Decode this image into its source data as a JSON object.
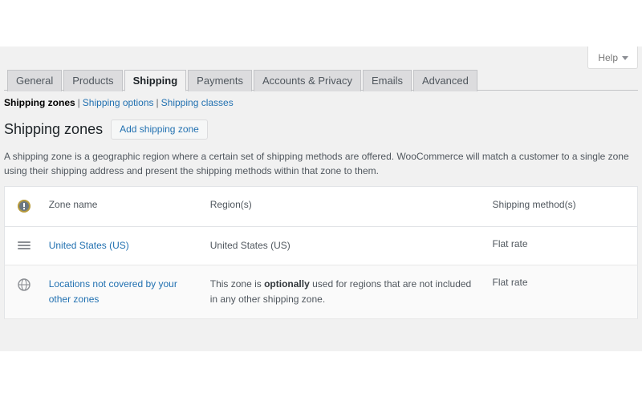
{
  "help": {
    "label": "Help",
    "caret_icon": "chevron-down-icon"
  },
  "tabs": [
    {
      "label": "General",
      "active": false
    },
    {
      "label": "Products",
      "active": false
    },
    {
      "label": "Shipping",
      "active": true
    },
    {
      "label": "Payments",
      "active": false
    },
    {
      "label": "Accounts & Privacy",
      "active": false
    },
    {
      "label": "Emails",
      "active": false
    },
    {
      "label": "Advanced",
      "active": false
    }
  ],
  "subnav": {
    "separator": "|",
    "items": [
      {
        "label": "Shipping zones",
        "current": true
      },
      {
        "label": "Shipping options",
        "current": false
      },
      {
        "label": "Shipping classes",
        "current": false
      }
    ]
  },
  "page": {
    "title": "Shipping zones",
    "action_button": "Add shipping zone",
    "description": "A shipping zone is a geographic region where a certain set of shipping methods are offered. WooCommerce will match a customer to a single zone using their shipping address and present the shipping methods within that zone to them."
  },
  "table": {
    "headers": {
      "help_icon": "help-tip-icon",
      "zone_name": "Zone name",
      "regions": "Region(s)",
      "methods": "Shipping method(s)"
    },
    "rows": [
      {
        "icon": "drag-handle-icon",
        "zone_name": "United States (US)",
        "region_prefix": "United States (US)",
        "region_bold": "",
        "region_suffix": "",
        "methods": "Flat rate"
      },
      {
        "icon": "globe-icon",
        "zone_name": "Locations not covered by your other zones",
        "region_prefix": "This zone is ",
        "region_bold": "optionally",
        "region_suffix": " used for regions that are not included in any other shipping zone.",
        "methods": "Flat rate"
      }
    ]
  },
  "colors": {
    "link": "#2271b1",
    "admin_background": "#f1f1f1",
    "tab_inactive": "#dcdcde",
    "border": "#c3c4c7",
    "text": "#50575e"
  }
}
